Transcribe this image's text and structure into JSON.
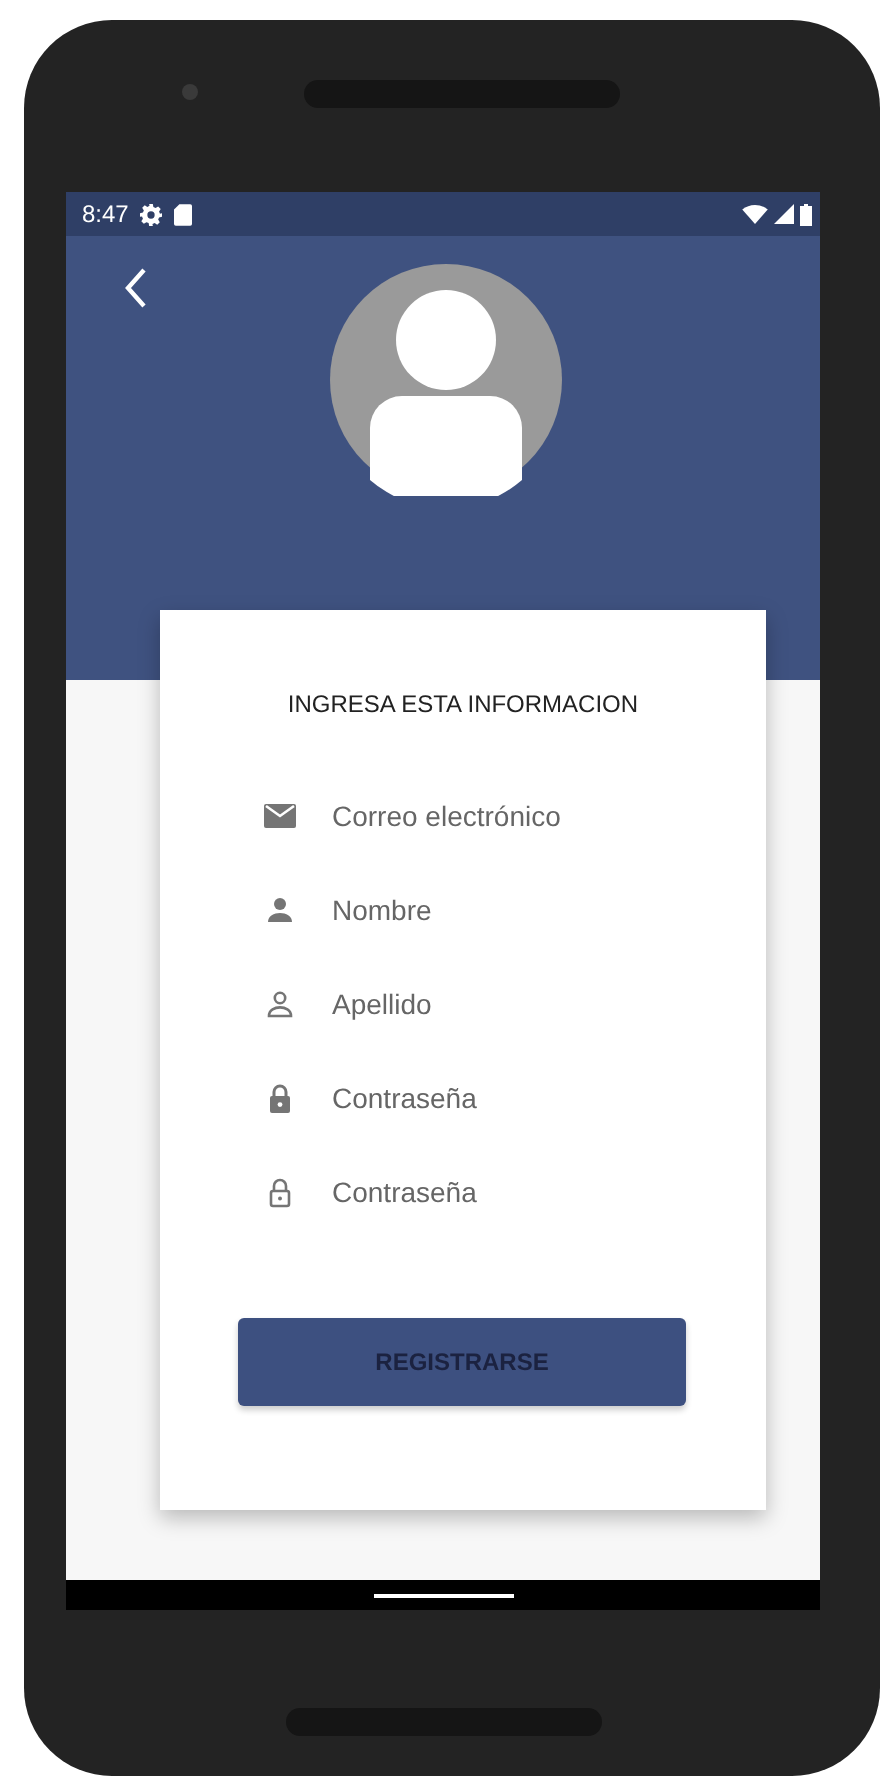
{
  "status_bar": {
    "time": "8:47"
  },
  "form": {
    "title": "INGRESA ESTA INFORMACION",
    "fields": [
      {
        "kind": "email",
        "placeholder": "Correo electrónico"
      },
      {
        "kind": "person",
        "placeholder": "Nombre"
      },
      {
        "kind": "person-outline",
        "placeholder": "Apellido"
      },
      {
        "kind": "lock",
        "placeholder": "Contraseña"
      },
      {
        "kind": "lock-outline",
        "placeholder": "Contraseña"
      }
    ],
    "button": "REGISTRARSE"
  }
}
